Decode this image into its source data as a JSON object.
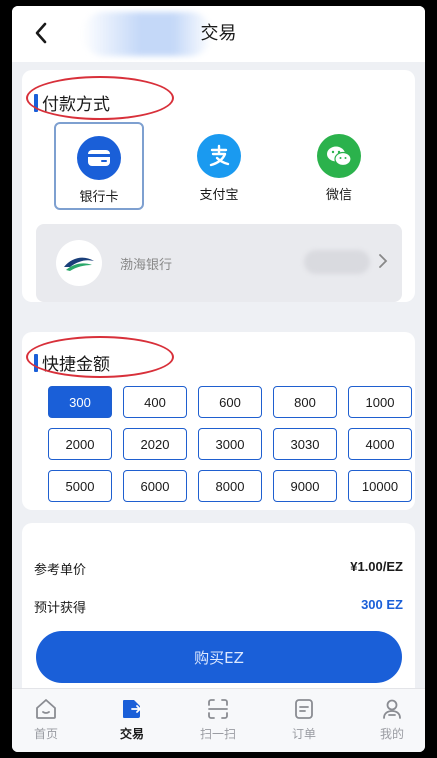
{
  "header": {
    "title": "交易"
  },
  "payment": {
    "section_title": "付款方式",
    "methods": [
      {
        "label": "银行卡",
        "icon": "bank-card-icon",
        "color": "#1a5fd8"
      },
      {
        "label": "支付宝",
        "icon": "alipay-icon",
        "color": "#1a9af0"
      },
      {
        "label": "微信",
        "icon": "wechat-icon",
        "color": "#2bb24c"
      }
    ],
    "bank": {
      "name": "渤海银行",
      "icon": "bohai-bank-logo-icon"
    }
  },
  "quick_amount": {
    "section_title": "快捷金额",
    "options": [
      "300",
      "400",
      "600",
      "800",
      "1000",
      "2000",
      "2020",
      "3000",
      "3030",
      "4000",
      "5000",
      "6000",
      "8000",
      "9000",
      "10000"
    ]
  },
  "summary": {
    "unit_price_label": "参考单价",
    "unit_price_value": "¥1.00/EZ",
    "expected_label": "预计获得",
    "expected_value": "300 EZ",
    "buy_label": "购买EZ"
  },
  "tabs": [
    {
      "label": "首页",
      "icon": "home-icon"
    },
    {
      "label": "交易",
      "icon": "trade-icon"
    },
    {
      "label": "扫一扫",
      "icon": "scan-icon"
    },
    {
      "label": "订单",
      "icon": "order-icon"
    },
    {
      "label": "我的",
      "icon": "profile-icon"
    }
  ],
  "colors": {
    "primary": "#1a5fd8",
    "highlight_oval": "#d8303a",
    "expected_value": "#1a5fd8"
  }
}
